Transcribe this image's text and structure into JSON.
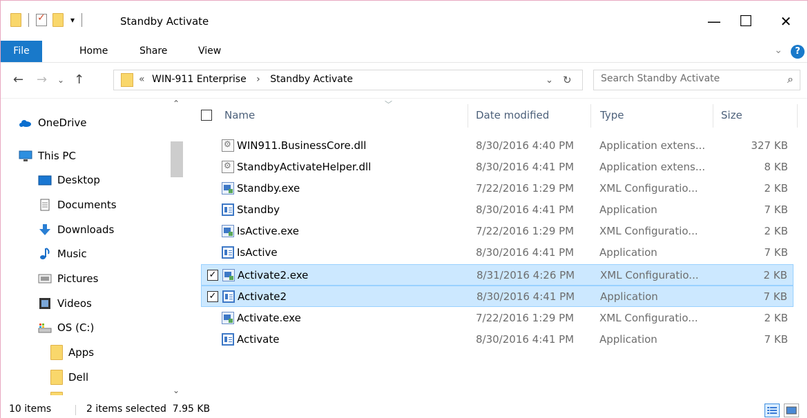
{
  "window": {
    "title": "Standby Activate",
    "controls": {
      "minimize": "—",
      "maximize": "☐",
      "close": "✕"
    }
  },
  "ribbon": {
    "tabs": [
      "File",
      "Home",
      "Share",
      "View"
    ],
    "help": "?"
  },
  "address": {
    "overflow": "«",
    "crumbs": [
      "WIN-911 Enterprise",
      "Standby Activate"
    ],
    "crumb_sep": "›",
    "search_placeholder": "Search Standby Activate"
  },
  "nav_pane": {
    "items": [
      {
        "label": "OneDrive",
        "icon": "cloud-icon"
      },
      {
        "label": "This PC",
        "icon": "computer-icon"
      },
      {
        "label": "Desktop",
        "icon": "desktop-icon"
      },
      {
        "label": "Documents",
        "icon": "documents-icon"
      },
      {
        "label": "Downloads",
        "icon": "downloads-icon"
      },
      {
        "label": "Music",
        "icon": "music-icon"
      },
      {
        "label": "Pictures",
        "icon": "pictures-icon"
      },
      {
        "label": "Videos",
        "icon": "videos-icon"
      },
      {
        "label": "OS (C:)",
        "icon": "drive-icon"
      },
      {
        "label": "Apps",
        "icon": "folder-icon"
      },
      {
        "label": "Dell",
        "icon": "folder-icon"
      }
    ]
  },
  "columns": {
    "name": "Name",
    "date": "Date modified",
    "type": "Type",
    "size": "Size"
  },
  "files": [
    {
      "name": "WIN911.BusinessCore.dll",
      "date": "8/30/2016 4:40 PM",
      "type": "Application extens...",
      "size": "327 KB",
      "icon": "dll-icon",
      "selected": false
    },
    {
      "name": "StandbyActivateHelper.dll",
      "date": "8/30/2016 4:41 PM",
      "type": "Application extens...",
      "size": "8 KB",
      "icon": "dll-icon",
      "selected": false
    },
    {
      "name": "Standby.exe",
      "date": "7/22/2016 1:29 PM",
      "type": "XML Configuratio...",
      "size": "2 KB",
      "icon": "xml-config-icon",
      "selected": false
    },
    {
      "name": "Standby",
      "date": "8/30/2016 4:41 PM",
      "type": "Application",
      "size": "7 KB",
      "icon": "application-icon",
      "selected": false
    },
    {
      "name": "IsActive.exe",
      "date": "7/22/2016 1:29 PM",
      "type": "XML Configuratio...",
      "size": "2 KB",
      "icon": "xml-config-icon",
      "selected": false
    },
    {
      "name": "IsActive",
      "date": "8/30/2016 4:41 PM",
      "type": "Application",
      "size": "7 KB",
      "icon": "application-icon",
      "selected": false
    },
    {
      "name": "Activate2.exe",
      "date": "8/31/2016 4:26 PM",
      "type": "XML Configuratio...",
      "size": "2 KB",
      "icon": "xml-config-icon",
      "selected": true
    },
    {
      "name": "Activate2",
      "date": "8/30/2016 4:41 PM",
      "type": "Application",
      "size": "7 KB",
      "icon": "application-icon",
      "selected": true
    },
    {
      "name": "Activate.exe",
      "date": "7/22/2016 1:29 PM",
      "type": "XML Configuratio...",
      "size": "2 KB",
      "icon": "xml-config-icon",
      "selected": false
    },
    {
      "name": "Activate",
      "date": "8/30/2016 4:41 PM",
      "type": "Application",
      "size": "7 KB",
      "icon": "application-icon",
      "selected": false
    }
  ],
  "status": {
    "item_count": "10 items",
    "selection": "2 items selected  7.95 KB"
  },
  "colors": {
    "accent": "#1979ca",
    "selection_bg": "#cce8ff",
    "selection_border": "#99d1ff",
    "header_text": "#4c607a"
  }
}
